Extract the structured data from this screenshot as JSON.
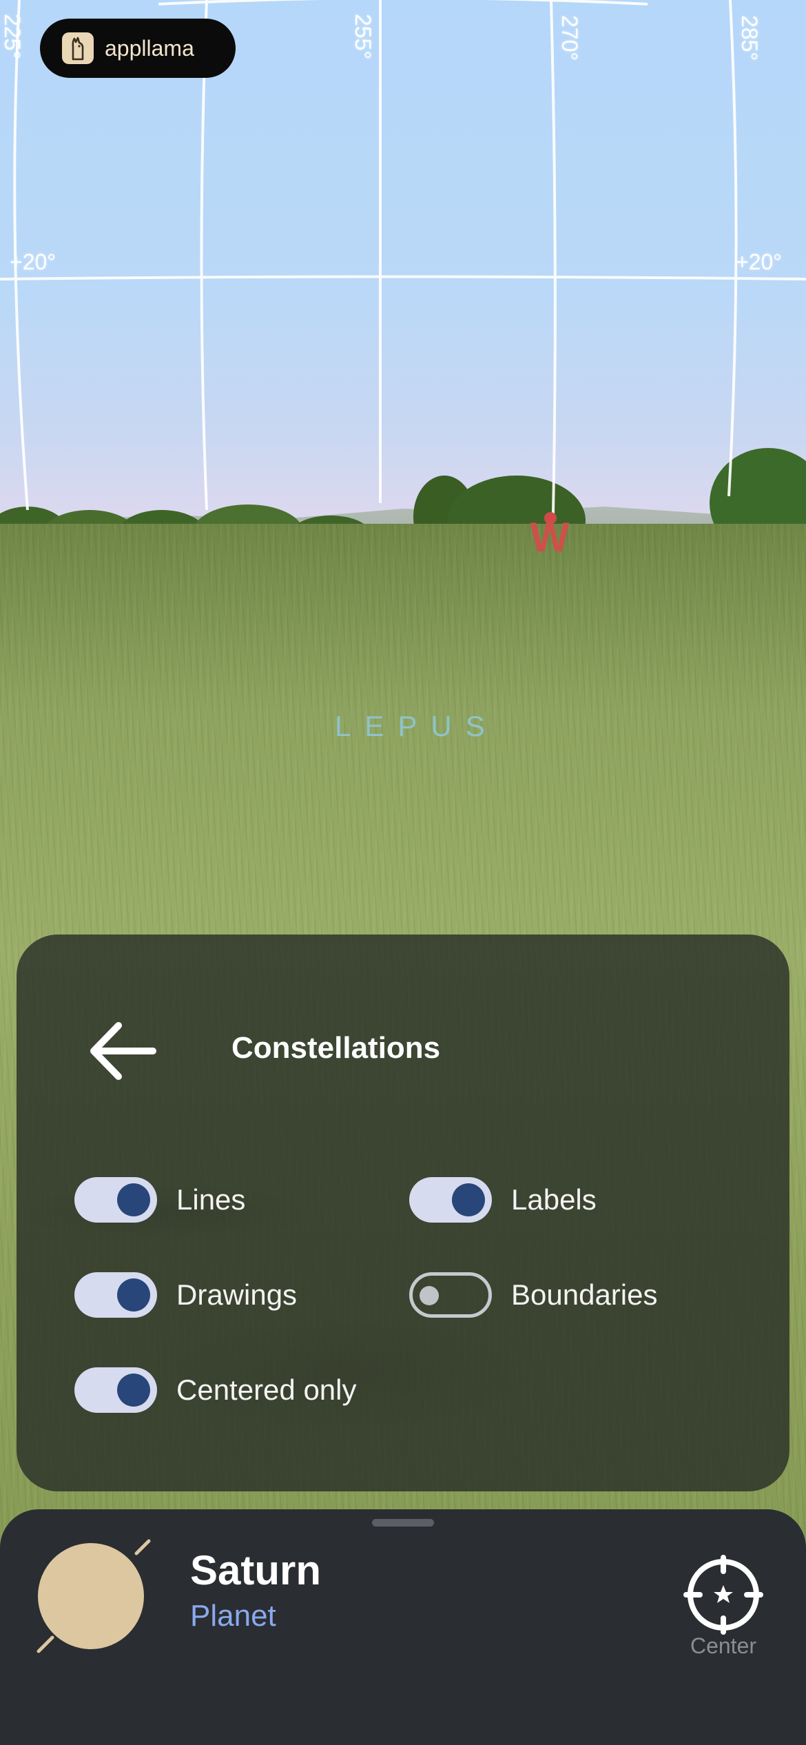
{
  "brand": {
    "name": "appllama",
    "logo_icon": "llama-icon"
  },
  "sky_overlay": {
    "azimuth_labels": [
      "225°",
      "255°",
      "270°",
      "285°"
    ],
    "altitude_labels": {
      "left": "+20°",
      "right": "+20°"
    },
    "cardinal": "W",
    "constellation_label": "LEPUS"
  },
  "panel": {
    "title": "Constellations",
    "back_icon": "arrow-left-icon",
    "options": [
      {
        "label": "Lines",
        "on": true
      },
      {
        "label": "Labels",
        "on": true
      },
      {
        "label": "Drawings",
        "on": true
      },
      {
        "label": "Boundaries",
        "on": false
      },
      {
        "label": "Centered only",
        "on": true
      }
    ]
  },
  "sheet": {
    "object_name": "Saturn",
    "object_type": "Planet",
    "center_label": "Center",
    "center_icon": "crosshair-star-icon"
  },
  "colors": {
    "toggle_on_track": "#d6dbef",
    "toggle_on_knob": "#284679",
    "object_type": "#89a9ef",
    "cardinal": "#cf4f4b",
    "planet": "#dcc7a0"
  }
}
